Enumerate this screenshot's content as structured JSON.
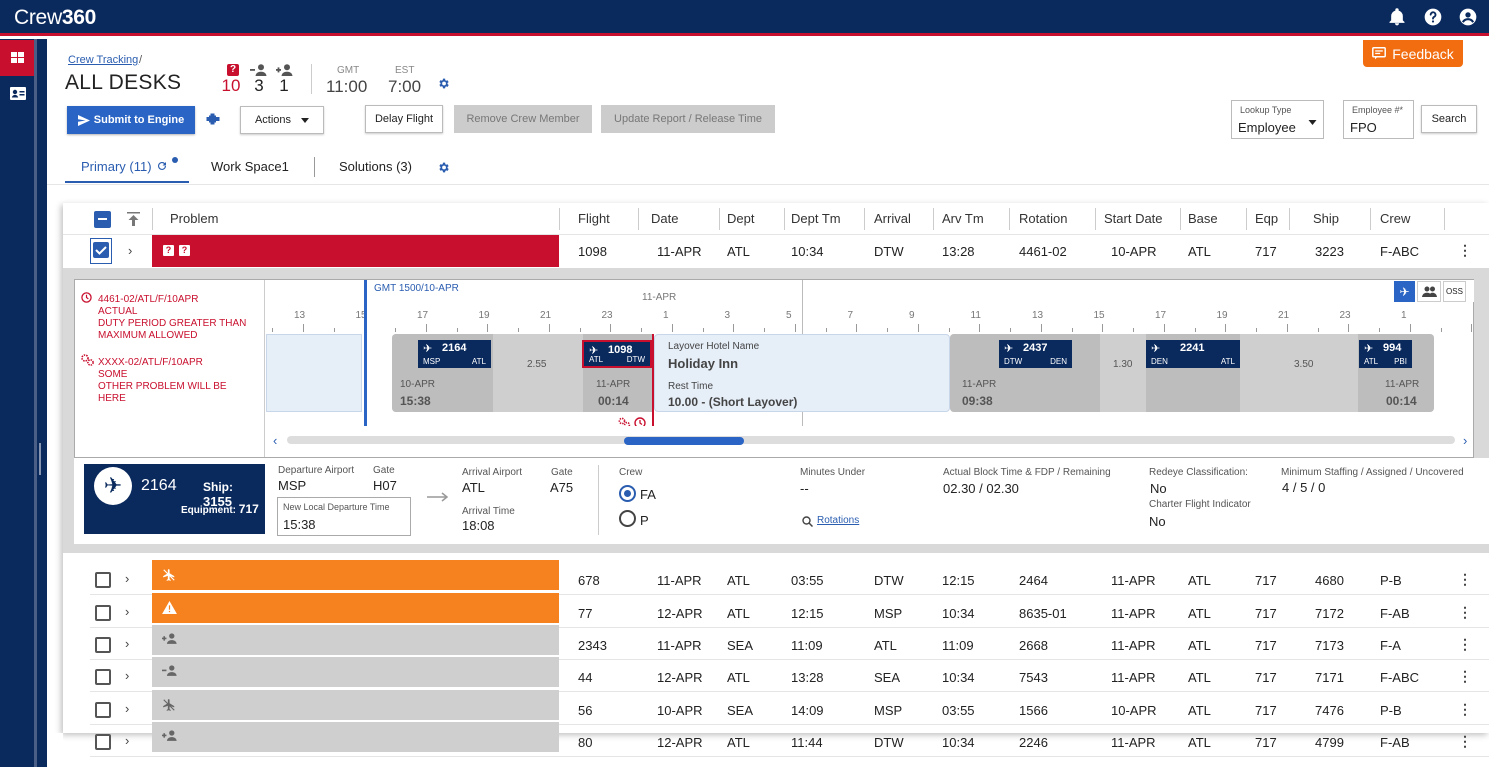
{
  "app": {
    "logo_light": "Crew",
    "logo_bold": "360"
  },
  "header": {
    "breadcrumb": "Crew Tracking",
    "breadcrumb_sep": "/",
    "title": "ALL DESKS",
    "counts": {
      "problems": "10",
      "crew_minus": "3",
      "crew_plus": "1"
    },
    "clocks": [
      {
        "label": "GMT",
        "value": "11:00"
      },
      {
        "label": "EST",
        "value": "7:00"
      }
    ],
    "feedback_label": "Feedback"
  },
  "toolbar": {
    "submit_label": "Submit to Engine",
    "actions_label": "Actions",
    "delay_label": "Delay Flight",
    "remove_label": "Remove Crew Member",
    "update_label": "Update Report / Release Time",
    "lookup_label": "Lookup Type",
    "lookup_value": "Employee",
    "employee_label": "Employee #*",
    "employee_value": "FPO",
    "search_label": "Search"
  },
  "tabs": [
    {
      "label": "Primary (11)"
    },
    {
      "label": "Work Space1"
    },
    {
      "label": "Solutions (3)"
    }
  ],
  "table": {
    "columns": [
      "Problem",
      "Flight",
      "Date",
      "Dept",
      "Dept Tm",
      "Arrival",
      "Arv Tm",
      "Rotation",
      "Start Date",
      "Base",
      "Eqp",
      "Ship",
      "Crew"
    ],
    "first_row": {
      "flight": "1098",
      "date": "11-APR",
      "dept": "ATL",
      "dept_tm": "10:34",
      "arrival": "DTW",
      "arv_tm": "13:28",
      "rotation": "4461-02",
      "start": "10-APR",
      "base": "ATL",
      "eqp": "717",
      "ship": "3223",
      "crew": "F-ABC"
    },
    "rows": [
      {
        "flight": "678",
        "date": "11-APR",
        "dept": "ATL",
        "dept_tm": "03:55",
        "arrival": "DTW",
        "arv_tm": "12:15",
        "rotation": "2464",
        "start": "11-APR",
        "base": "ATL",
        "eqp": "717",
        "ship": "4680",
        "crew": "P-B"
      },
      {
        "flight": "77",
        "date": "12-APR",
        "dept": "ATL",
        "dept_tm": "12:15",
        "arrival": "MSP",
        "arv_tm": "10:34",
        "rotation": "8635-01",
        "start": "11-APR",
        "base": "ATL",
        "eqp": "717",
        "ship": "7172",
        "crew": "F-AB"
      },
      {
        "flight": "2343",
        "date": "11-APR",
        "dept": "SEA",
        "dept_tm": "11:09",
        "arrival": "ATL",
        "arv_tm": "11:09",
        "rotation": "2668",
        "start": "11-APR",
        "base": "ATL",
        "eqp": "717",
        "ship": "7173",
        "crew": "F-A"
      },
      {
        "flight": "44",
        "date": "12-APR",
        "dept": "ATL",
        "dept_tm": "13:28",
        "arrival": "SEA",
        "arv_tm": "10:34",
        "rotation": "7543",
        "start": "11-APR",
        "base": "ATL",
        "eqp": "717",
        "ship": "7171",
        "crew": "F-ABC"
      },
      {
        "flight": "56",
        "date": "10-APR",
        "dept": "SEA",
        "dept_tm": "14:09",
        "arrival": "MSP",
        "arv_tm": "03:55",
        "rotation": "1566",
        "start": "10-APR",
        "base": "ATL",
        "eqp": "717",
        "ship": "7476",
        "crew": "P-B"
      },
      {
        "flight": "80",
        "date": "12-APR",
        "dept": "ATL",
        "dept_tm": "11:44",
        "arrival": "DTW",
        "arv_tm": "10:34",
        "rotation": "2246",
        "start": "11-APR",
        "base": "ATL",
        "eqp": "717",
        "ship": "4799",
        "crew": "F-AB"
      }
    ]
  },
  "errors": [
    {
      "line1": "4461-02/ATL/F/10APR",
      "line2": "ACTUAL",
      "line3": "DUTY PERIOD GREATER THAN",
      "line4": "MAXIMUM ALLOWED"
    },
    {
      "line1": "XXXX-02/ATL/F/10APR",
      "line2": "SOME",
      "line3": "OTHER PROBLEM WILL BE",
      "line4": "HERE"
    }
  ],
  "timeline": {
    "gmt_marker": "GMT 1500/10-APR",
    "day_label": "11-APR",
    "oss": "OSS",
    "hours": [
      "13",
      "15",
      "17",
      "19",
      "21",
      "23",
      "1",
      "3",
      "5",
      "7",
      "9",
      "11",
      "13",
      "15",
      "17",
      "19",
      "21",
      "23",
      "1"
    ],
    "flights": [
      {
        "num": "2164",
        "from": "MSP",
        "to": "ATL",
        "date": "10-APR",
        "time": "15:38"
      },
      {
        "num": "1098",
        "from": "ATL",
        "to": "DTW",
        "date": "11-APR",
        "time": "00:14"
      },
      {
        "num": "2437",
        "from": "DTW",
        "to": "DEN",
        "date": "11-APR",
        "time": "09:38"
      },
      {
        "num": "2241",
        "from": "DEN",
        "to": "ATL"
      },
      {
        "num": "994",
        "from": "ATL",
        "to": "PBI",
        "date": "11-APR",
        "time": "00:14"
      }
    ],
    "gaps": [
      "2.55",
      "1.30",
      "3.50"
    ],
    "layover": {
      "hotel_label": "Layover Hotel Name",
      "hotel": "Holiday Inn",
      "rest_label": "Rest Time",
      "rest": "10.00 - (Short Layover)"
    }
  },
  "detail": {
    "flight": "2164",
    "ship_label": "Ship:",
    "ship": "3155",
    "equip_label": "Equipment:",
    "equip": "717",
    "dep_label": "Departure Airport",
    "dep": "MSP",
    "gate_label": "Gate",
    "dep_gate": "H07",
    "new_dep_label": "New Local Departure Time",
    "new_dep": "15:38",
    "arr_label": "Arrival Airport",
    "arr": "ATL",
    "arr_gate": "A75",
    "arr_time_label": "Arrival Time",
    "arr_time": "18:08",
    "crew_label": "Crew",
    "crew_fa": "FA",
    "crew_p": "P",
    "min_under_label": "Minutes Under",
    "min_under": "--",
    "rotations_link": "Rotations",
    "block_label": "Actual Block Time & FDP / Remaining",
    "block": "02.30 / 02.30",
    "redeye_label": "Redeye Classification:",
    "redeye": "No",
    "charter_label": "Charter Flight Indicator",
    "charter": "No",
    "staff_label": "Minimum Staffing / Assigned / Uncovered",
    "staff": "4 / 5 / 0"
  },
  "colors": {
    "navy": "#0a2a5e",
    "red": "#c8102e",
    "orange": "#f5821f",
    "blue": "#2a64c4",
    "grey": "#cfcfcf"
  }
}
